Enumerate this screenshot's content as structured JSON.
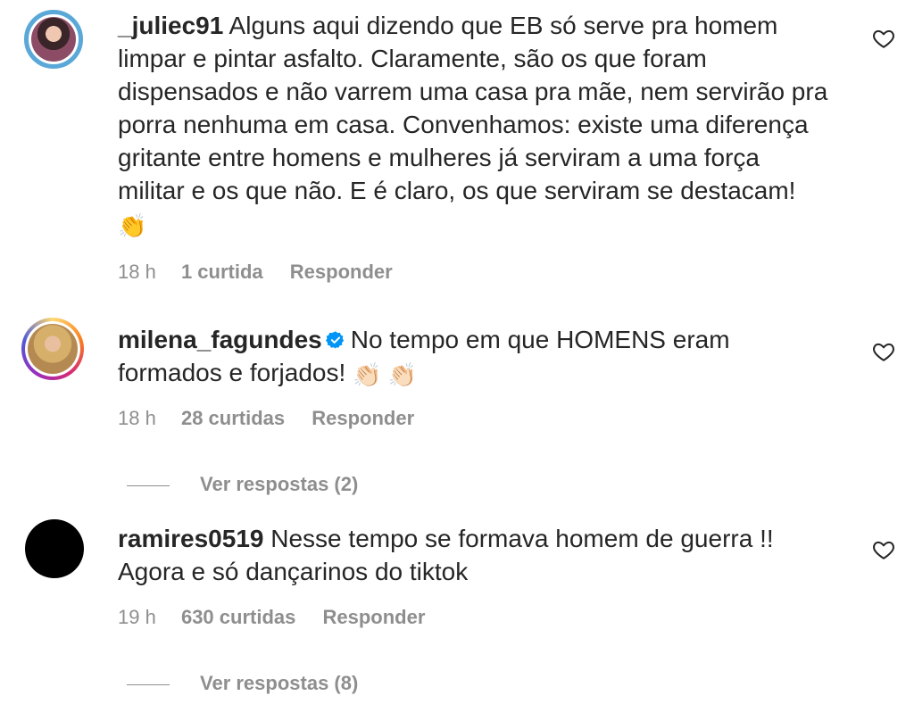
{
  "comments": [
    {
      "username": "_juliec91",
      "verified": false,
      "text": "Alguns aqui dizendo que EB só serve pra homem limpar e pintar asfalto. Claramente, são os que foram dispensados e não varrem uma casa pra mãe, nem servirão pra porra nenhuma em casa. Convenhamos: existe uma diferença gritante entre homens e mulheres já serviram a uma força militar e os que não. E é claro, os que serviram se destacam!",
      "emoji": "👏",
      "time": "18 h",
      "likes": "1 curtida",
      "reply_label": "Responder",
      "view_replies": null
    },
    {
      "username": "milena_fagundes",
      "verified": true,
      "text": "No tempo em que HOMENS eram formados e forjados!",
      "emoji": "👏🏻 👏🏻",
      "time": "18 h",
      "likes": "28 curtidas",
      "reply_label": "Responder",
      "view_replies": "Ver respostas (2)"
    },
    {
      "username": "ramires0519",
      "verified": false,
      "text": "Nesse tempo se formava homem de guerra !! Agora e só dançarinos do tiktok",
      "emoji": "",
      "time": "19 h",
      "likes": "630 curtidas",
      "reply_label": "Responder",
      "view_replies": "Ver respostas (8)"
    }
  ],
  "colors": {
    "text": "#262626",
    "meta": "#8e8e8e",
    "verified": "#0095f6"
  },
  "icons": {
    "like": "heart-outline-icon",
    "verified": "verified-badge-icon"
  }
}
